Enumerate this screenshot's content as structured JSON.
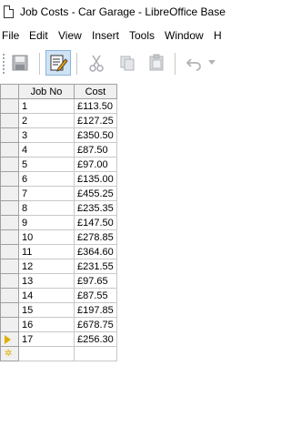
{
  "window": {
    "title": "Job Costs - Car Garage - LibreOffice Base"
  },
  "menu": [
    "File",
    "Edit",
    "View",
    "Insert",
    "Tools",
    "Window",
    "H"
  ],
  "grid": {
    "columns": [
      "Job No",
      "Cost"
    ],
    "rows": [
      [
        "1",
        "£113.50"
      ],
      [
        "2",
        "£127.25"
      ],
      [
        "3",
        "£350.50"
      ],
      [
        "4",
        "£87.50"
      ],
      [
        "5",
        "£97.00"
      ],
      [
        "6",
        "£135.00"
      ],
      [
        "7",
        "£455.25"
      ],
      [
        "8",
        "£235.35"
      ],
      [
        "9",
        "£147.50"
      ],
      [
        "10",
        "£278.85"
      ],
      [
        "11",
        "£364.60"
      ],
      [
        "12",
        "£231.55"
      ],
      [
        "13",
        "£97.65"
      ],
      [
        "14",
        "£87.55"
      ],
      [
        "15",
        "£197.85"
      ],
      [
        "16",
        "£678.75"
      ],
      [
        "17",
        "£256.30"
      ]
    ],
    "current_row": 17,
    "current_marker_color": "#e0b000"
  },
  "icons": [
    "document-icon",
    "save-icon",
    "edit-icon",
    "cut-icon",
    "copy-icon",
    "paste-icon",
    "undo-icon"
  ]
}
